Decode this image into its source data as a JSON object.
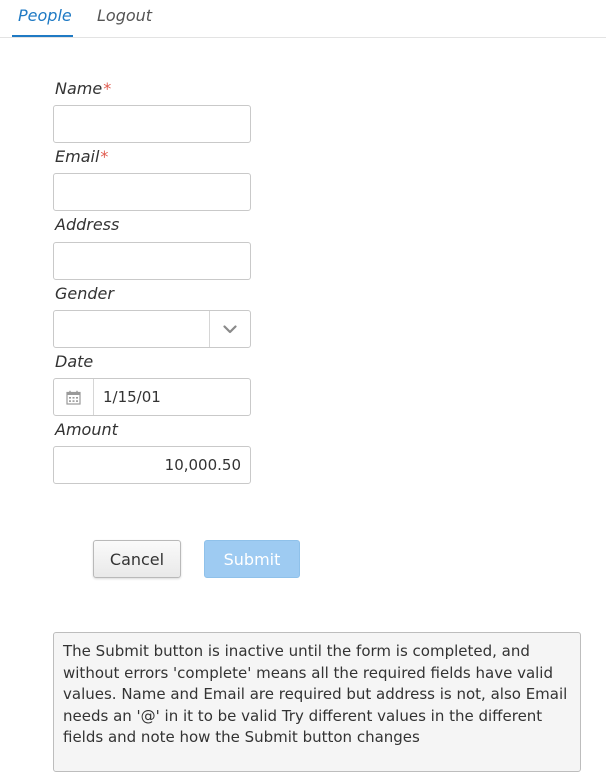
{
  "tabs": {
    "people": "People",
    "logout": "Logout"
  },
  "form": {
    "name_label": "Name",
    "email_label": "Email",
    "address_label": "Address",
    "gender_label": "Gender",
    "date_label": "Date",
    "amount_label": "Amount",
    "required_mark": "*",
    "name_value": "",
    "email_value": "",
    "address_value": "",
    "gender_value": "",
    "date_value": "1/15/01",
    "amount_value": "10,000.50"
  },
  "buttons": {
    "cancel": "Cancel",
    "submit": "Submit",
    "submit_enabled": false
  },
  "note": "The Submit button is inactive until the form is completed, and without errors 'complete' means all the required fields have valid values. Name and Email are required but address is not, also Email needs an '@' in it to be valid Try different values in the different fields and note how the Submit button changes",
  "colors": {
    "accent": "#1f7ac4",
    "required": "#e05a4e",
    "submit_disabled": "#9ecbf2"
  },
  "icons": {
    "gender_dropdown": "chevron-down-icon",
    "date_picker": "calendar-icon"
  }
}
